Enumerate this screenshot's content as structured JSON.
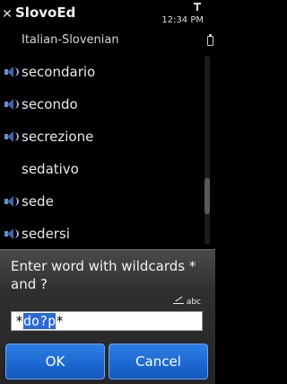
{
  "app": {
    "title": "SlovoEd",
    "clock": "12:34 PM"
  },
  "subtitle": "Italian-Slovenian",
  "list": [
    {
      "label": "secondario",
      "audio": true
    },
    {
      "label": "secondo",
      "audio": true
    },
    {
      "label": "secrezione",
      "audio": true
    },
    {
      "label": "sedativo",
      "audio": false
    },
    {
      "label": "sede",
      "audio": true
    },
    {
      "label": "sedersi",
      "audio": true
    }
  ],
  "dialog": {
    "title": "Enter word with wildcards * and ?",
    "input_mode": "abc",
    "input": {
      "prefix": "*",
      "selected": "do?p",
      "suffix": "*"
    },
    "ok_label": "OK",
    "cancel_label": "Cancel"
  },
  "colors": {
    "accent": "#1f6bd8",
    "speaker": "#3d63a8",
    "background": "#000000"
  },
  "icons": [
    "close-icon",
    "signal-icon",
    "battery-icon",
    "speaker-icon",
    "pen-icon"
  ]
}
